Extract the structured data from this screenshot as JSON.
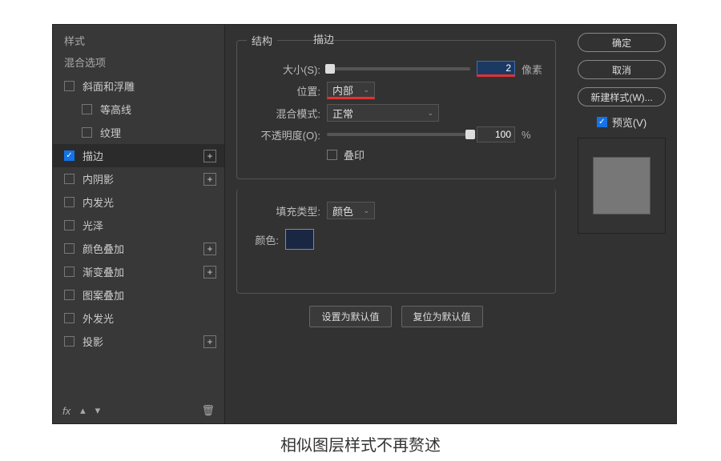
{
  "sidebar": {
    "styles_header": "样式",
    "blend_header": "混合选项",
    "items": [
      {
        "label": "斜面和浮雕",
        "checked": false,
        "plus": false,
        "indent": 0
      },
      {
        "label": "等高线",
        "checked": false,
        "plus": false,
        "indent": 1
      },
      {
        "label": "纹理",
        "checked": false,
        "plus": false,
        "indent": 1
      },
      {
        "label": "描边",
        "checked": true,
        "plus": true,
        "indent": 0,
        "active": true
      },
      {
        "label": "内阴影",
        "checked": false,
        "plus": true,
        "indent": 0
      },
      {
        "label": "内发光",
        "checked": false,
        "plus": false,
        "indent": 0
      },
      {
        "label": "光泽",
        "checked": false,
        "plus": false,
        "indent": 0
      },
      {
        "label": "颜色叠加",
        "checked": false,
        "plus": true,
        "indent": 0
      },
      {
        "label": "渐变叠加",
        "checked": false,
        "plus": true,
        "indent": 0
      },
      {
        "label": "图案叠加",
        "checked": false,
        "plus": false,
        "indent": 0
      },
      {
        "label": "外发光",
        "checked": false,
        "plus": false,
        "indent": 0
      },
      {
        "label": "投影",
        "checked": false,
        "plus": true,
        "indent": 0
      }
    ],
    "fx_label": "fx"
  },
  "panel_title": "描边",
  "structure": {
    "legend": "结构",
    "size_label": "大小(S):",
    "size_value": "2",
    "size_unit": "像素",
    "pos_label": "位置:",
    "pos_value": "内部",
    "blend_label": "混合模式:",
    "blend_value": "正常",
    "opacity_label": "不透明度(O):",
    "opacity_value": "100",
    "opacity_unit": "%",
    "overprint_label": "叠印"
  },
  "fill": {
    "type_label": "填充类型:",
    "type_value": "颜色",
    "color_label": "颜色:"
  },
  "actions": {
    "defaults": "设置为默认值",
    "reset": "复位为默认值"
  },
  "right": {
    "ok": "确定",
    "cancel": "取消",
    "newstyle": "新建样式(W)...",
    "preview": "预览(V)"
  },
  "caption": "相似图层样式不再赘述"
}
